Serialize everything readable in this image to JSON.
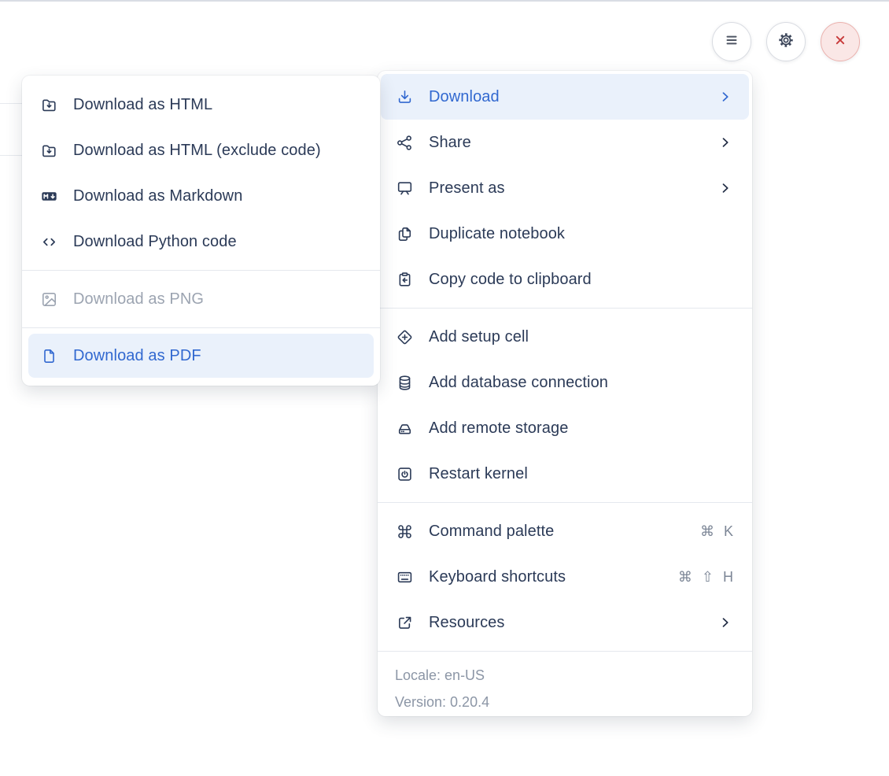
{
  "colors": {
    "accent_blue": "#3168D0",
    "highlight_bg": "#EAF1FB",
    "text_dark": "#2B3A57",
    "text_footer": "#8C96A6",
    "text_disabled": "#9CA4B1",
    "danger_red": "#C83B3B",
    "danger_bg": "#FAE7E6",
    "divider": "#E5E8EE"
  },
  "window_controls": {
    "menu_button": "hamburger-menu",
    "settings_button": "settings",
    "close_button": "close"
  },
  "menu": {
    "groups": [
      {
        "items": [
          {
            "label": "Download",
            "icon": "download-icon",
            "has_submenu": true,
            "state": "active"
          },
          {
            "label": "Share",
            "icon": "share-icon",
            "has_submenu": true
          },
          {
            "label": "Present as",
            "icon": "present-screen-icon",
            "has_submenu": true
          },
          {
            "label": "Duplicate notebook",
            "icon": "duplicate-pages-icon"
          },
          {
            "label": "Copy code to clipboard",
            "icon": "clipboard-arrow-icon"
          }
        ]
      },
      {
        "items": [
          {
            "label": "Add setup cell",
            "icon": "diamond-plus-icon"
          },
          {
            "label": "Add database connection",
            "icon": "database-icon"
          },
          {
            "label": "Add remote storage",
            "icon": "storage-drive-icon"
          },
          {
            "label": "Restart kernel",
            "icon": "power-square-icon"
          }
        ]
      },
      {
        "items": [
          {
            "label": "Command palette",
            "icon": "command-icon",
            "shortcut": "⌘ K"
          },
          {
            "label": "Keyboard shortcuts",
            "icon": "keyboard-icon",
            "shortcut": "⌘ ⇧ H"
          },
          {
            "label": "Resources",
            "icon": "external-link-icon",
            "has_submenu": true
          }
        ]
      }
    ],
    "footer": {
      "locale": "Locale: en-US",
      "version": "Version: 0.20.4"
    }
  },
  "download_submenu": {
    "groups": [
      {
        "items": [
          {
            "label": "Download as HTML",
            "icon": "folder-download-icon"
          },
          {
            "label": "Download as HTML (exclude code)",
            "icon": "folder-download-icon"
          },
          {
            "label": "Download as Markdown",
            "icon": "markdown-icon"
          },
          {
            "label": "Download Python code",
            "icon": "code-brackets-icon"
          }
        ]
      },
      {
        "items": [
          {
            "label": "Download as PNG",
            "icon": "image-icon",
            "state": "disabled"
          }
        ]
      },
      {
        "items": [
          {
            "label": "Download as PDF",
            "icon": "file-icon",
            "state": "active"
          }
        ]
      }
    ]
  }
}
